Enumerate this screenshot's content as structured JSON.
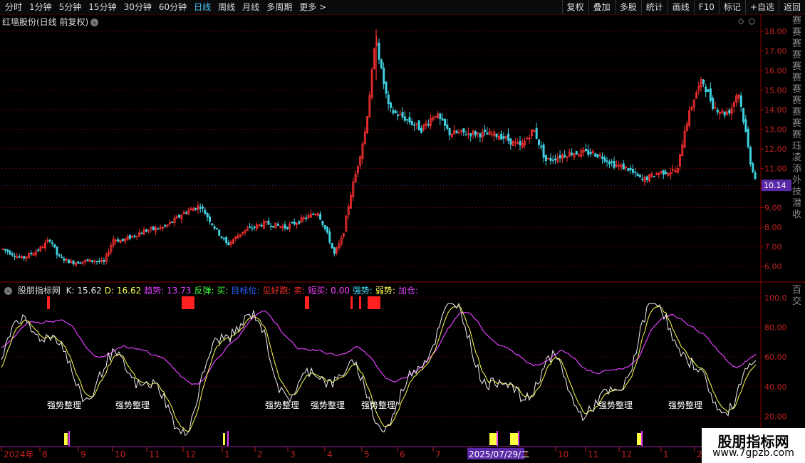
{
  "toolbar": {
    "periods": [
      "分时",
      "1分钟",
      "5分钟",
      "15分钟",
      "30分钟",
      "60分钟",
      "日线",
      "周线",
      "月线",
      "多周期",
      "更多 >"
    ],
    "active_period": "日线",
    "right_buttons": [
      "复权",
      "叠加",
      "多股",
      "统计",
      "画线",
      "F10",
      "标记",
      "+自选",
      "返回"
    ]
  },
  "main": {
    "title": "红墙股份(日线 前复权)",
    "price_labels": [
      "18.00",
      "17.00",
      "16.00",
      "15.00",
      "14.00",
      "13.00",
      "12.00",
      "11.00",
      "10.00",
      "9.00",
      "8.00",
      "7.00",
      "6.00"
    ],
    "current_price": "10.14",
    "colors": {
      "up": "#ff3030",
      "down": "#40d0e0",
      "grid": "#5a0000",
      "current": "#5a2aa8"
    }
  },
  "indicator": {
    "source": "股朋指标网",
    "header": [
      {
        "label": "K: 15.62",
        "color": "#e8e8e8"
      },
      {
        "label": "D: 16.62",
        "color": "#ffff50"
      },
      {
        "label": "趋势: 13.73",
        "color": "#e040fb"
      },
      {
        "label": "反弹: 买:",
        "color": "#40ff40"
      },
      {
        "label": "目标位:",
        "color": "#3060ff"
      },
      {
        "label": "见好跑: 卖:",
        "color": "#ff3030"
      },
      {
        "label": "短买: 0.00",
        "color": "#ff40ff"
      },
      {
        "label": "强势:",
        "color": "#40e0ff"
      },
      {
        "label": "弱势:",
        "color": "#ffff50"
      },
      {
        "label": "加仓:",
        "color": "#e040fb"
      }
    ],
    "ytick_labels": [
      "100.0",
      "80.00",
      "60.00",
      "40.00",
      "20.00"
    ],
    "zone_text": "强势整理"
  },
  "xaxis": {
    "labels": [
      "2024年",
      "8",
      "9",
      "10",
      "11",
      "12",
      "1",
      "2",
      "3",
      "4",
      "5",
      "6",
      "7",
      "8",
      "9",
      "10",
      "11",
      "12",
      "1",
      "2"
    ],
    "cursor_date": "2025/07/29/二"
  },
  "right_strip": {
    "top_chars": "赛赛赛赛赛赛赛赛赛赛赛珏凌添外技潜收",
    "bottom_chars": "百交"
  },
  "watermark": {
    "line1": "股朋指标网",
    "line2": "www.7gpzb.com"
  }
}
